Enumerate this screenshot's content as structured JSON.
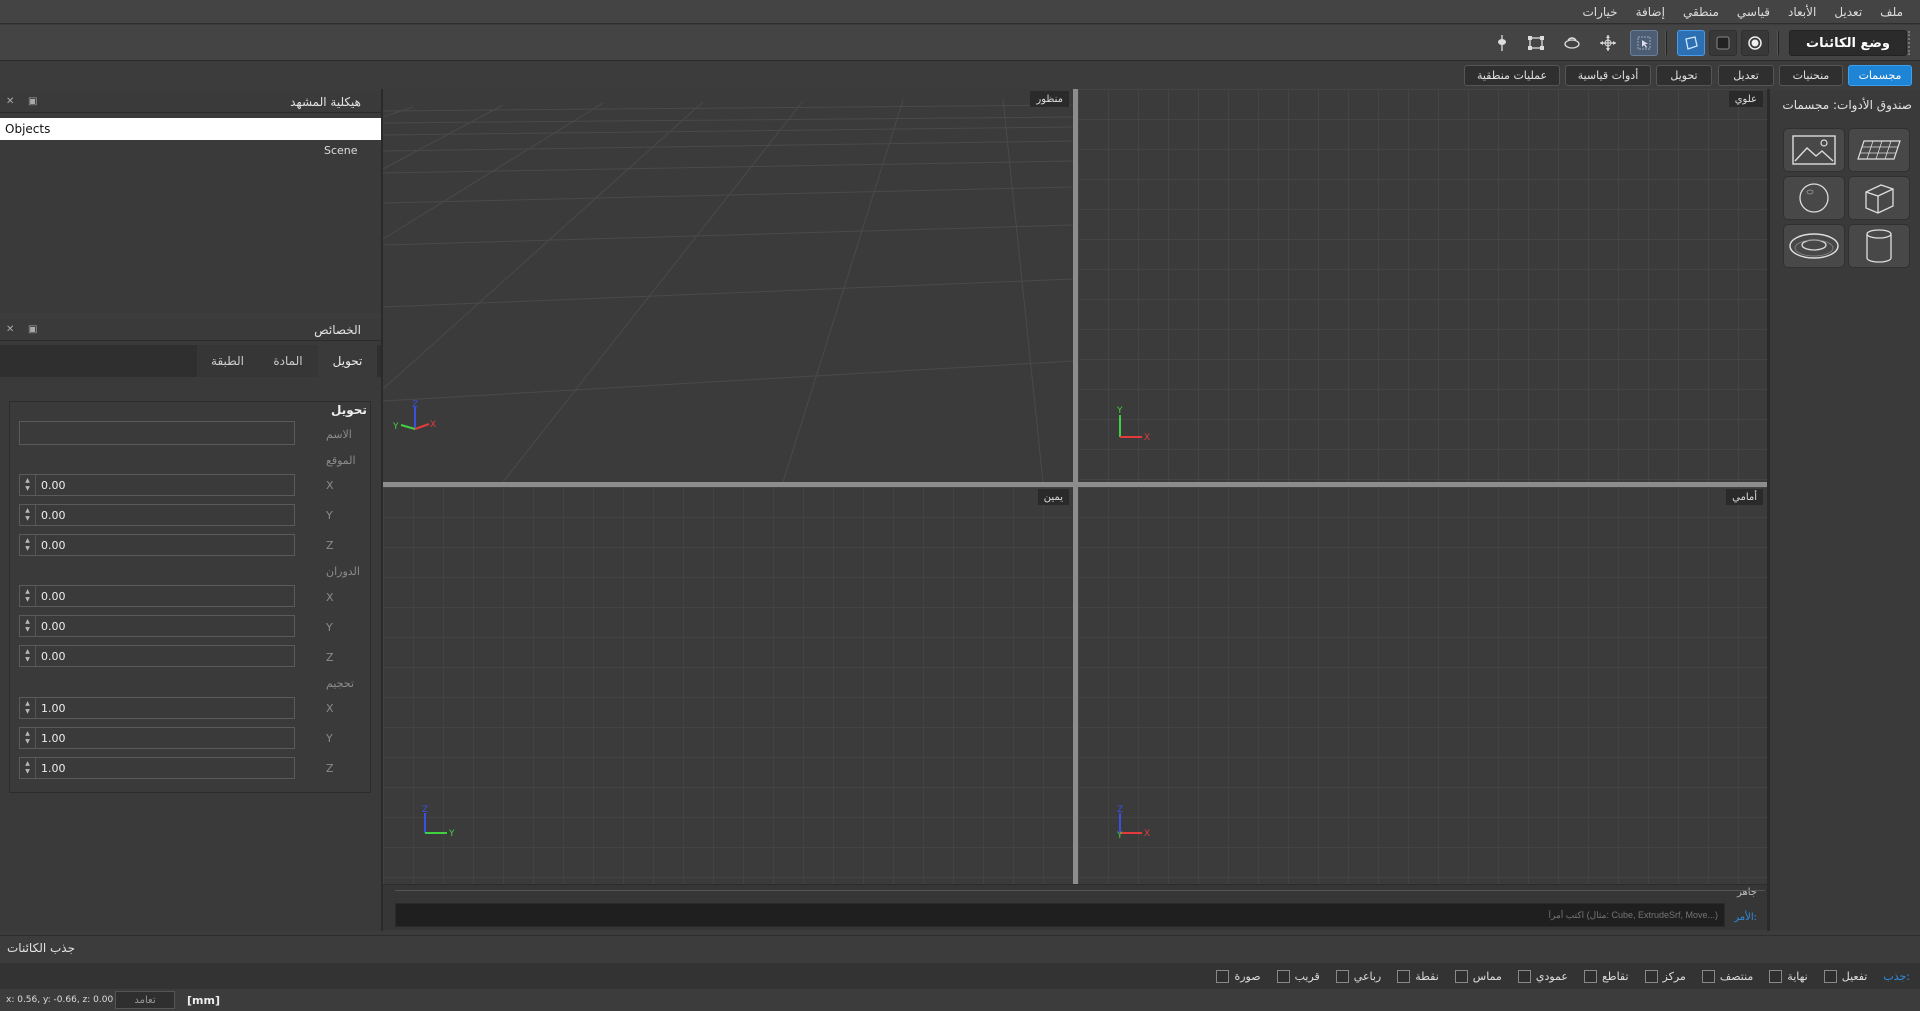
{
  "menu": [
    "ملف",
    "تعديل",
    "الأبعاد",
    "قياسي",
    "منطقي",
    "إضافة",
    "خيارات"
  ],
  "toolbar": {
    "mode_label": "وضع الكائنات"
  },
  "tabs": [
    {
      "label": "مجسمات",
      "active": true
    },
    {
      "label": "منحنيات",
      "active": false
    },
    {
      "label": "تعديل",
      "active": false
    },
    {
      "label": "تحويل",
      "active": false
    },
    {
      "label": "أدوات قياسية",
      "active": false
    },
    {
      "label": "عمليات منطقية",
      "active": false
    }
  ],
  "scene_panel": {
    "title": "هيكلية المشهد",
    "selected_item": "Objects",
    "items": [
      "Scene"
    ]
  },
  "properties_panel": {
    "title": "الخصائص",
    "tabs": [
      "تحويل",
      "المادة",
      "الطبقة"
    ],
    "section": "تحويل",
    "name_label": "الاسم",
    "name_value": "",
    "position_label": "الموقع",
    "rotation_label": "الدوران",
    "scale_label": "تحجيم",
    "axes": [
      "X",
      "Y",
      "Z"
    ],
    "position": [
      "0.00",
      "0.00",
      "0.00"
    ],
    "rotation": [
      "0.00",
      "0.00",
      "0.00"
    ],
    "scale": [
      "1.00",
      "1.00",
      "1.00"
    ]
  },
  "toolbox": {
    "title": "صندوق الأدوات: مجسمات",
    "tools": [
      "plane-icon",
      "image-icon",
      "cube-icon",
      "sphere-icon",
      "cylinder-icon",
      "torus-icon"
    ]
  },
  "viewports": [
    {
      "label": "منظور",
      "axes": [
        "Z",
        "Y",
        "X"
      ]
    },
    {
      "label": "علوي",
      "axes": [
        "Y",
        "X"
      ]
    },
    {
      "label": "يمين",
      "axes": [
        "Z",
        "Y"
      ]
    },
    {
      "label": "أمامي",
      "axes": [
        "Z",
        "X",
        "Y"
      ]
    }
  ],
  "console": {
    "status": "جاهز",
    "prompt": "الأمر:",
    "placeholder": "اكتب أمراً (مثال: Cube, ExtrudeSrf, Move...)"
  },
  "snap": {
    "title": "جذب الكائنات",
    "label": "جذب:",
    "options": [
      "تفعيل",
      "نهاية",
      "منتصف",
      "مركز",
      "تقاطع",
      "عمودي",
      "مماس",
      "نقطة",
      "رباعي",
      "قريب",
      "صورة"
    ]
  },
  "status": {
    "coords": "x: 0.56, y: -0.66, z: 0.00",
    "ortho_label": "تعامد",
    "units": "[mm]"
  },
  "colors": {
    "accent": "#1e84d6",
    "axis_x": "#e23b3b",
    "axis_y": "#3fd13f",
    "axis_z": "#3b4fe2"
  }
}
